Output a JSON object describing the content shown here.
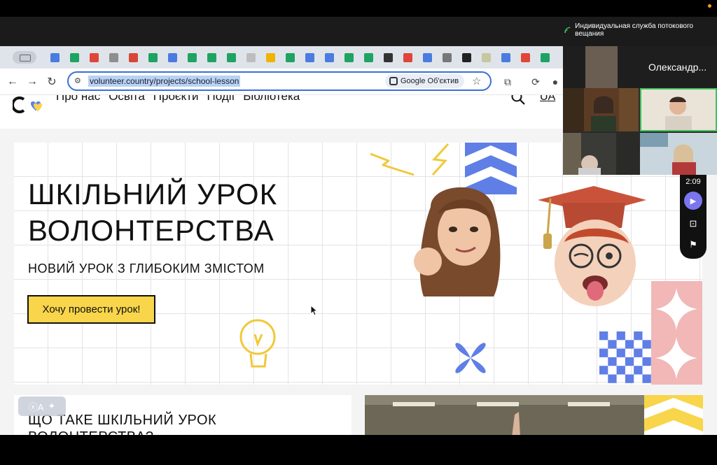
{
  "zoom": {
    "banner_text": "Индивидуальная служба потокового вещания",
    "participant_name": "Олександр...",
    "timer": "2:09"
  },
  "browser": {
    "url": "volunteer.country/projects/school-lesson",
    "lens_label": "Google Об'єктив",
    "tab_icon_colors": [
      "#4a7be0",
      "#1ea362",
      "#e0453a",
      "#8e8e8e",
      "#d94536",
      "#1ea362",
      "#4a7be0",
      "#1ea362",
      "#1ea362",
      "#1ea362",
      "#bdbdbd",
      "#f0b400",
      "#1ea362",
      "#4a7be0",
      "#4a7be0",
      "#1ea362",
      "#1ea362",
      "#333333",
      "#e0453a",
      "#4a7be0",
      "#777777",
      "#222222",
      "#c7c7a0",
      "#4a7be0",
      "#e0453a",
      "#1ea362"
    ]
  },
  "site": {
    "nav": [
      "Про нас",
      "Освіта",
      "Проєкти",
      "Події",
      "Бібліотека"
    ],
    "lang": "UA",
    "hero_title": "ШКІЛЬНИЙ УРОК ВОЛОНТЕРСТВА",
    "hero_subtitle": "НОВИЙ УРОК З ГЛИБОКИМ ЗМІСТОМ",
    "cta_label": "Хочу провести урок!",
    "section_title": "ЩО ТАКЕ ШКІЛЬНИЙ УРОК ВОЛОНТЕРСТВА?",
    "translate_chip": "ⓧA"
  },
  "colors": {
    "accent_yellow": "#f8d54a",
    "accent_blue": "#5f7ee6",
    "accent_pink": "#f2b7b7",
    "zoom_purple": "#7b76f0"
  }
}
